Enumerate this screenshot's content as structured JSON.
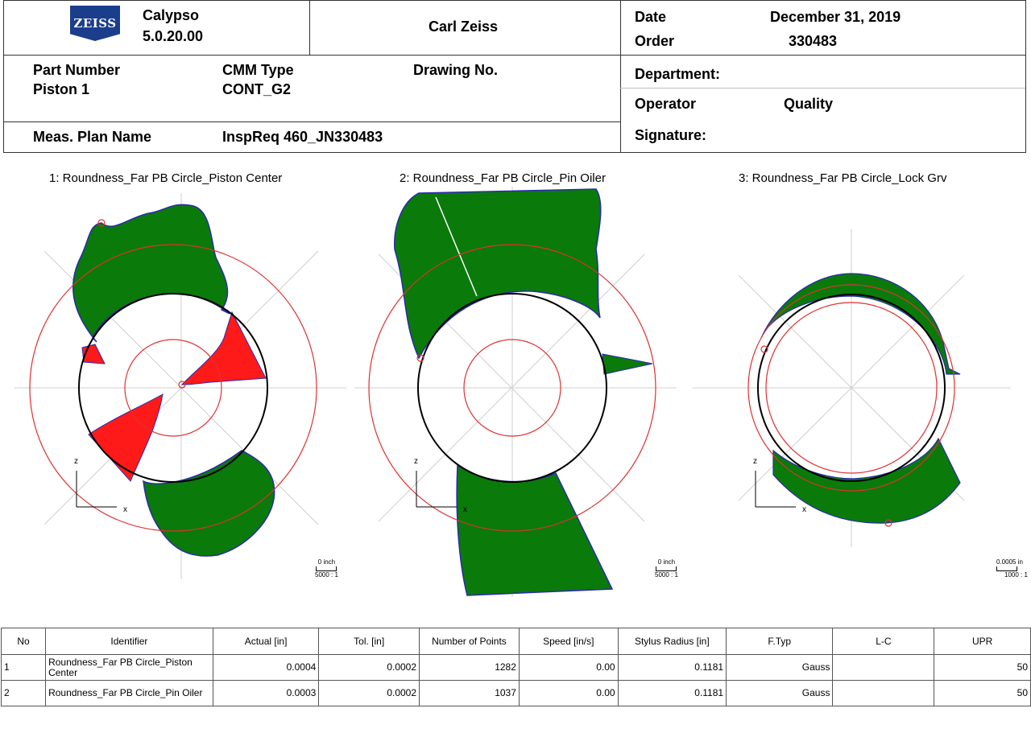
{
  "header": {
    "logo_text": "ZEISS",
    "app_name": "Calypso",
    "app_version": "5.0.20.00",
    "company": "Carl Zeiss",
    "date_label": "Date",
    "date_value": "December 31, 2019",
    "order_label": "Order",
    "order_value": "330483",
    "part_number_label": "Part Number",
    "part_number_value": "Piston 1",
    "cmm_type_label": "CMM Type",
    "cmm_type_value": "CONT_G2",
    "drawing_label": "Drawing No.",
    "department_label": "Department:",
    "operator_label": "Operator",
    "operator_value": "Quality",
    "meas_plan_label": "Meas. Plan Name",
    "meas_plan_value": "InspReq 460_JN330483",
    "signature_label": "Signature:"
  },
  "plots": [
    {
      "title": "1: Roundness_Far PB Circle_Piston Center",
      "scale_value": "0 inch",
      "scale_ratio": "5000 : 1"
    },
    {
      "title": "2: Roundness_Far PB Circle_Pin Oiler",
      "scale_value": "0 inch",
      "scale_ratio": "5000 : 1"
    },
    {
      "title": "3: Roundness_Far PB Circle_Lock Grv",
      "scale_value": "0.0005 in",
      "scale_ratio": "1000 : 1"
    }
  ],
  "axes": {
    "x": "x",
    "z": "z"
  },
  "colors": {
    "deviation_fill": "#0a7a0a",
    "deviation_edge": "#2a2ab0",
    "tolerance_circle": "#e03030",
    "under_fill": "#ff1a1a",
    "logo_blue": "#1a3d8c"
  },
  "table": {
    "columns": [
      "No",
      "Identifier",
      "Actual [in]",
      "Tol. [in]",
      "Number of Points",
      "Speed [in/s]",
      "Stylus Radius [in]",
      "F.Typ",
      "L-C",
      "UPR"
    ],
    "rows": [
      [
        "1",
        "Roundness_Far PB Circle_Piston Center",
        "0.0004",
        "0.0002",
        "1282",
        "0.00",
        "0.1181",
        "Gauss",
        "",
        "50"
      ],
      [
        "2",
        "Roundness_Far PB Circle_Pin Oiler",
        "0.0003",
        "0.0002",
        "1037",
        "0.00",
        "0.1181",
        "Gauss",
        "",
        "50"
      ]
    ]
  }
}
